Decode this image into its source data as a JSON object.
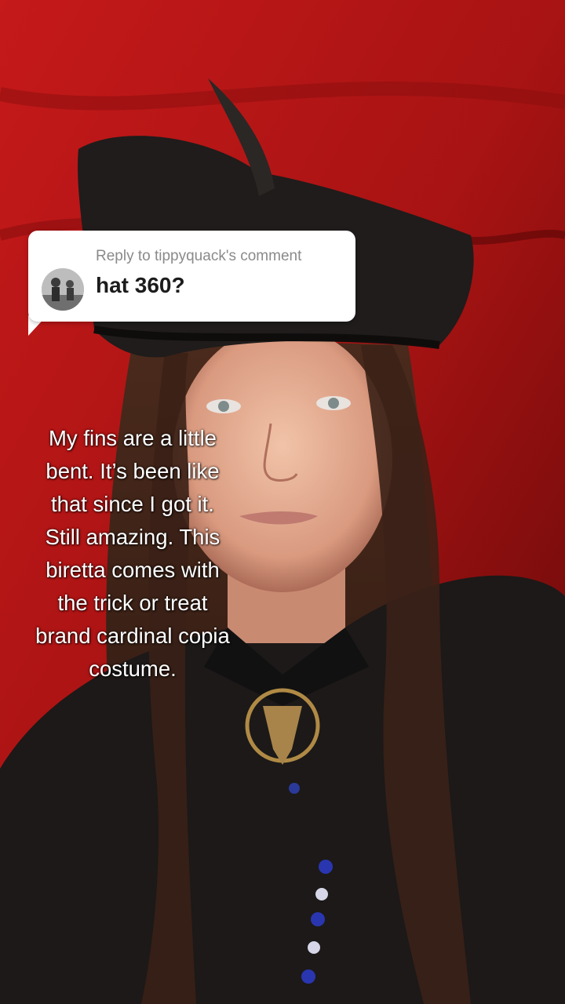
{
  "reply_bubble": {
    "reply_label": "Reply to tippyquack's comment",
    "comment": "hat 360?"
  },
  "caption": {
    "lines": [
      "My fins are a little",
      "bent. It’s been like",
      "that since I got it.",
      "Still amazing. This",
      "biretta comes with",
      "the trick or treat",
      "brand cardinal copia",
      "costume."
    ]
  },
  "colors": {
    "backdrop_red": "#b31212",
    "hat_black": "#1f1c1b",
    "bubble_white": "#ffffff",
    "caption_white": "#ffffff"
  },
  "icons": {
    "avatar": "commenter-avatar-photo"
  }
}
